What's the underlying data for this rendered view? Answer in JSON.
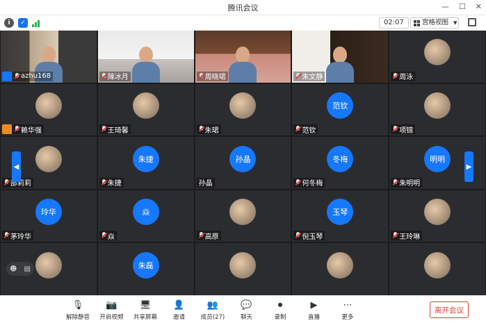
{
  "window": {
    "title": "腾讯会议"
  },
  "toolbar": {
    "timer": "02:07",
    "view_mode": "宫格视图"
  },
  "tiles": [
    {
      "name": "azhu168",
      "kind": "video",
      "scene": "s1",
      "badge": "host"
    },
    {
      "name": "陳冰月",
      "kind": "video",
      "scene": "s2"
    },
    {
      "name": "周晓珺",
      "kind": "video",
      "scene": "s3"
    },
    {
      "name": "朱文静",
      "kind": "video",
      "scene": "s4"
    },
    {
      "name": "周泳",
      "kind": "photo"
    },
    {
      "name": "赖华强",
      "kind": "photo",
      "badge": "cohost"
    },
    {
      "name": "王琦馨",
      "kind": "photo"
    },
    {
      "name": "朱珺",
      "kind": "photo"
    },
    {
      "name": "范钦",
      "kind": "text",
      "avatar_text": "范钦"
    },
    {
      "name": "项锦",
      "kind": "photo"
    },
    {
      "name": "邵莉莉",
      "kind": "photo"
    },
    {
      "name": "朱捷",
      "kind": "text",
      "avatar_text": "朱捷"
    },
    {
      "name": "孙晶",
      "kind": "text",
      "avatar_text": "孙晶",
      "no_mic": true
    },
    {
      "name": "何冬梅",
      "kind": "text",
      "avatar_text": "冬梅"
    },
    {
      "name": "朱明明",
      "kind": "text",
      "avatar_text": "明明"
    },
    {
      "name": "茅玲华",
      "kind": "text",
      "avatar_text": "玲华"
    },
    {
      "name": "焱",
      "kind": "text",
      "avatar_text": "焱"
    },
    {
      "name": "高原",
      "kind": "photo"
    },
    {
      "name": "倪玉琴",
      "kind": "text",
      "avatar_text": "玉琴"
    },
    {
      "name": "王玲琳",
      "kind": "photo"
    },
    {
      "name": "",
      "kind": "photo"
    },
    {
      "name": "",
      "kind": "text",
      "avatar_text": "朱磊"
    },
    {
      "name": "",
      "kind": "photo"
    },
    {
      "name": "",
      "kind": "photo"
    },
    {
      "name": "",
      "kind": "photo"
    }
  ],
  "bottombar": {
    "items": [
      {
        "label": "解除静音",
        "icon": "mic-muted-icon",
        "glyph": "🎙"
      },
      {
        "label": "开启视频",
        "icon": "camera-off-icon",
        "glyph": "📷"
      },
      {
        "label": "共享屏幕",
        "icon": "share-screen-icon",
        "glyph": "🖥"
      },
      {
        "label": "邀请",
        "icon": "invite-icon",
        "glyph": "👤"
      },
      {
        "label": "成员(27)",
        "icon": "members-icon",
        "glyph": "👥"
      },
      {
        "label": "聊天",
        "icon": "chat-icon",
        "glyph": "💬"
      },
      {
        "label": "录制",
        "icon": "record-icon",
        "glyph": "⏺"
      },
      {
        "label": "直播",
        "icon": "live-icon",
        "glyph": "▶"
      },
      {
        "label": "更多",
        "icon": "more-icon",
        "glyph": "⋯"
      }
    ],
    "leave_label": "离开会议"
  },
  "colors": {
    "accent": "#1677ff",
    "danger": "#e53935",
    "grid_bg": "#1b1b1d",
    "tile_bg": "#2b2c2f"
  }
}
